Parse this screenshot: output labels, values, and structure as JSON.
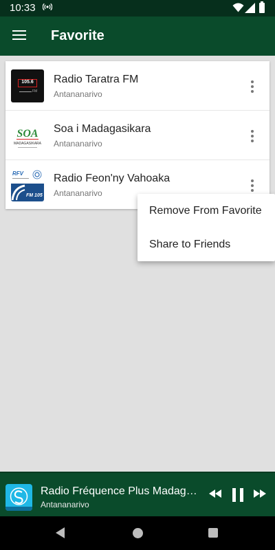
{
  "status_bar": {
    "time": "10:33",
    "icons": [
      "radio-broadcast-icon",
      "wifi-icon",
      "cell-signal-icon",
      "battery-icon"
    ]
  },
  "app_bar": {
    "title": "Favorite",
    "menu_icon": "hamburger-menu-icon"
  },
  "favorites": [
    {
      "name": "Radio Taratra FM",
      "city": "Antananarivo",
      "logo_text": "105.6",
      "logo_subtext": "FM"
    },
    {
      "name": "Soa i Madagasikara",
      "city": "Antananarivo",
      "logo_text": "SOA",
      "logo_subtext": "MADAGASIKARA"
    },
    {
      "name": "Radio Feon'ny Vahoaka",
      "city": "Antananarivo",
      "logo_text": "RFV",
      "logo_subtext": "FM 105"
    }
  ],
  "popup_menu": {
    "items": [
      "Remove From Favorite",
      "Share to Friends"
    ]
  },
  "player": {
    "title": "Radio Fréquence Plus Madagascar",
    "city": "Antananarivo",
    "controls": [
      "rewind-icon",
      "pause-icon",
      "fast-forward-icon"
    ]
  },
  "nav_bar": {
    "buttons": [
      "back-icon",
      "home-icon",
      "recents-icon"
    ]
  },
  "colors": {
    "app_bar": "#0a4b2b",
    "status_bar": "#062f1c",
    "background": "#e0e0e0",
    "accent_red": "#d62020",
    "logo_blue": "#1c4f8c",
    "player_logo": "#1fb8e6"
  }
}
